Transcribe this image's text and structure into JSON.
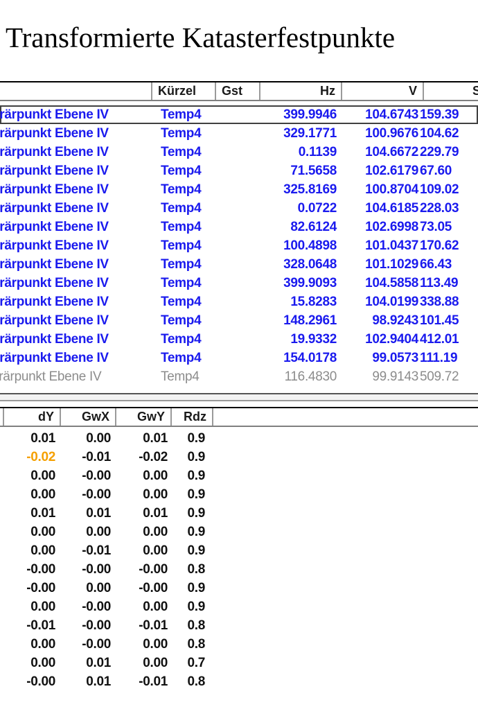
{
  "title": "Transformierte Katasterfestpunkte",
  "top_table": {
    "headers": [
      "Kürzel",
      "Gst",
      "Hz",
      "V",
      "S"
    ],
    "rows": [
      {
        "name": "orärpunkt Ebene IV",
        "kurz": "Temp4",
        "hz": "399.9946",
        "v": "104.6743",
        "s": "159.39",
        "style": "blue"
      },
      {
        "name": "orärpunkt Ebene IV",
        "kurz": "Temp4",
        "hz": "329.1771",
        "v": "100.9676",
        "s": "104.62",
        "style": "blue"
      },
      {
        "name": "orärpunkt Ebene IV",
        "kurz": "Temp4",
        "hz": "0.1139",
        "v": "104.6672",
        "s": "229.79",
        "style": "blue"
      },
      {
        "name": "orärpunkt Ebene IV",
        "kurz": "Temp4",
        "hz": "71.5658",
        "v": "102.6179",
        "s": "67.60",
        "style": "blue"
      },
      {
        "name": "orärpunkt Ebene IV",
        "kurz": "Temp4",
        "hz": "325.8169",
        "v": "100.8704",
        "s": "109.02",
        "style": "blue"
      },
      {
        "name": "orärpunkt Ebene IV",
        "kurz": "Temp4",
        "hz": "0.0722",
        "v": "104.6185",
        "s": "228.03",
        "style": "blue"
      },
      {
        "name": "orärpunkt Ebene IV",
        "kurz": "Temp4",
        "hz": "82.6124",
        "v": "102.6998",
        "s": "73.05",
        "style": "blue"
      },
      {
        "name": "orärpunkt Ebene IV",
        "kurz": "Temp4",
        "hz": "100.4898",
        "v": "101.0437",
        "s": "170.62",
        "style": "blue"
      },
      {
        "name": "orärpunkt Ebene IV",
        "kurz": "Temp4",
        "hz": "328.0648",
        "v": "101.1029",
        "s": "66.43",
        "style": "blue"
      },
      {
        "name": "orärpunkt Ebene IV",
        "kurz": "Temp4",
        "hz": "399.9093",
        "v": "104.5858",
        "s": "113.49",
        "style": "blue"
      },
      {
        "name": "orärpunkt Ebene IV",
        "kurz": "Temp4",
        "hz": "15.8283",
        "v": "104.0199",
        "s": "338.88",
        "style": "blue"
      },
      {
        "name": "orärpunkt Ebene IV",
        "kurz": "Temp4",
        "hz": "148.2961",
        "v": "98.9243",
        "s": "101.45",
        "style": "blue"
      },
      {
        "name": "orärpunkt Ebene IV",
        "kurz": "Temp4",
        "hz": "19.9332",
        "v": "102.9404",
        "s": "412.01",
        "style": "blue"
      },
      {
        "name": "orärpunkt Ebene IV",
        "kurz": "Temp4",
        "hz": "154.0178",
        "v": "99.0573",
        "s": "111.19",
        "style": "blue"
      },
      {
        "name": "orärpunkt Ebene IV",
        "kurz": "Temp4",
        "hz": "116.4830",
        "v": "99.9143",
        "s": "509.72",
        "style": "grey"
      }
    ]
  },
  "bottom_table": {
    "headers": [
      "dY",
      "GwX",
      "GwY",
      "Rdz"
    ],
    "rows": [
      {
        "dy": "0.01",
        "gwx": "0.00",
        "gwy": "0.01",
        "rdz": "0.9"
      },
      {
        "dy": "-0.02",
        "gwx": "-0.01",
        "gwy": "-0.02",
        "rdz": "0.9",
        "dy_color": "#f5a000"
      },
      {
        "dy": "0.00",
        "gwx": "-0.00",
        "gwy": "0.00",
        "rdz": "0.9"
      },
      {
        "dy": "0.00",
        "gwx": "-0.00",
        "gwy": "0.00",
        "rdz": "0.9"
      },
      {
        "dy": "0.01",
        "gwx": "0.01",
        "gwy": "0.01",
        "rdz": "0.9"
      },
      {
        "dy": "0.00",
        "gwx": "0.00",
        "gwy": "0.00",
        "rdz": "0.9"
      },
      {
        "dy": "0.00",
        "gwx": "-0.01",
        "gwy": "0.00",
        "rdz": "0.9"
      },
      {
        "dy": "-0.00",
        "gwx": "-0.00",
        "gwy": "-0.00",
        "rdz": "0.8"
      },
      {
        "dy": "-0.00",
        "gwx": "0.00",
        "gwy": "-0.00",
        "rdz": "0.9"
      },
      {
        "dy": "0.00",
        "gwx": "-0.00",
        "gwy": "0.00",
        "rdz": "0.9"
      },
      {
        "dy": "-0.01",
        "gwx": "-0.00",
        "gwy": "-0.01",
        "rdz": "0.8"
      },
      {
        "dy": "0.00",
        "gwx": "-0.00",
        "gwy": "0.00",
        "rdz": "0.8"
      },
      {
        "dy": "0.00",
        "gwx": "0.01",
        "gwy": "0.00",
        "rdz": "0.7"
      },
      {
        "dy": "-0.00",
        "gwx": "0.01",
        "gwy": "-0.01",
        "rdz": "0.8"
      }
    ]
  },
  "colors": {
    "blue_text": "#1a1aee",
    "grey_text": "#8c8c8c",
    "warn_text": "#f5a000"
  }
}
